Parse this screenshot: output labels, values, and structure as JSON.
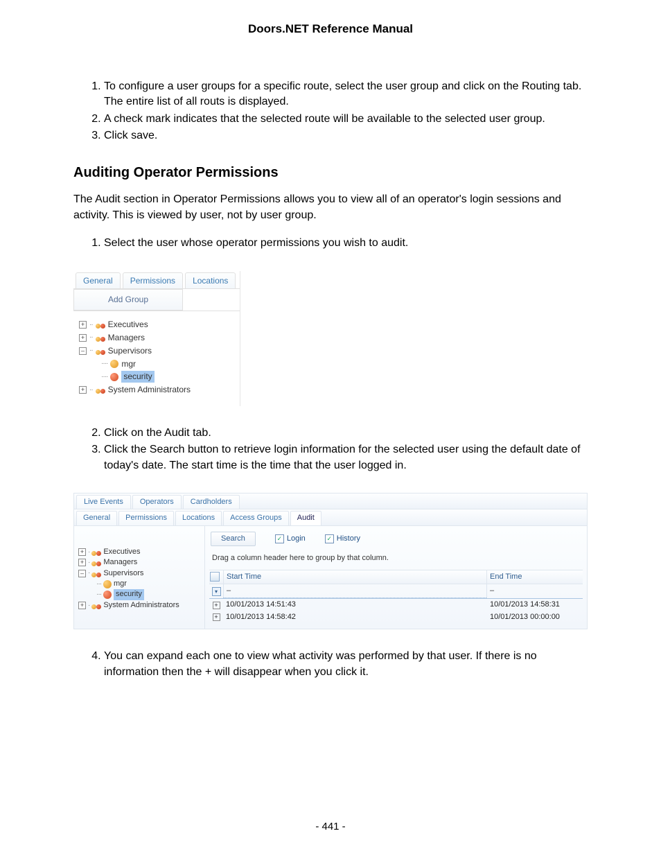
{
  "doc_title": "Doors.NET Reference Manual",
  "intro_list": {
    "item1": "To configure a user groups for a specific route, select the user group and click on the Routing tab. The entire list of all routs is displayed.",
    "item2": "A check mark indicates that the selected route will be available to the selected user group.",
    "item3": "Click save."
  },
  "section_heading": "Auditing Operator Permissions",
  "section_intro": "The Audit section in Operator Permissions allows you to view all of an operator's login sessions and activity. This is viewed by user, not by user group.",
  "step1": "Select the user whose operator permissions you wish to audit.",
  "ss1": {
    "tabs": {
      "general": "General",
      "permissions": "Permissions",
      "locations": "Locations"
    },
    "add_group": "Add Group",
    "nodes": {
      "executives": "Executives",
      "managers": "Managers",
      "supervisors": "Supervisors",
      "mgr": "mgr",
      "security": "security",
      "sysadmins": "System Administrators"
    }
  },
  "step2": "Click on the Audit tab.",
  "step3": "Click the Search button to retrieve login information for the selected user using the default date of today's date. The start time is the time that the user logged in.",
  "ss2": {
    "toptabs": {
      "live_events": "Live Events",
      "operators": "Operators",
      "cardholders": "Cardholders"
    },
    "subtabs": {
      "general": "General",
      "permissions": "Permissions",
      "locations": "Locations",
      "access_groups": "Access Groups",
      "audit": "Audit"
    },
    "tree": {
      "executives": "Executives",
      "managers": "Managers",
      "supervisors": "Supervisors",
      "mgr": "mgr",
      "security": "security",
      "sysadmins": "System Administrators"
    },
    "toolbar": {
      "search": "Search",
      "login": "Login",
      "history": "History"
    },
    "group_hint": "Drag a column header here to group by that column.",
    "columns": {
      "start": "Start Time",
      "end": "End Time"
    },
    "filter_dash1": "–",
    "filter_dash2": "–",
    "rows": [
      {
        "start": "10/01/2013 14:51:43",
        "end": "10/01/2013 14:58:31"
      },
      {
        "start": "10/01/2013 14:58:42",
        "end": "10/01/2013 00:00:00"
      }
    ]
  },
  "step4": "You can expand each one to view what activity was performed by that user. If there is no information then the + will disappear when you click it.",
  "page_number": "- 441 -"
}
